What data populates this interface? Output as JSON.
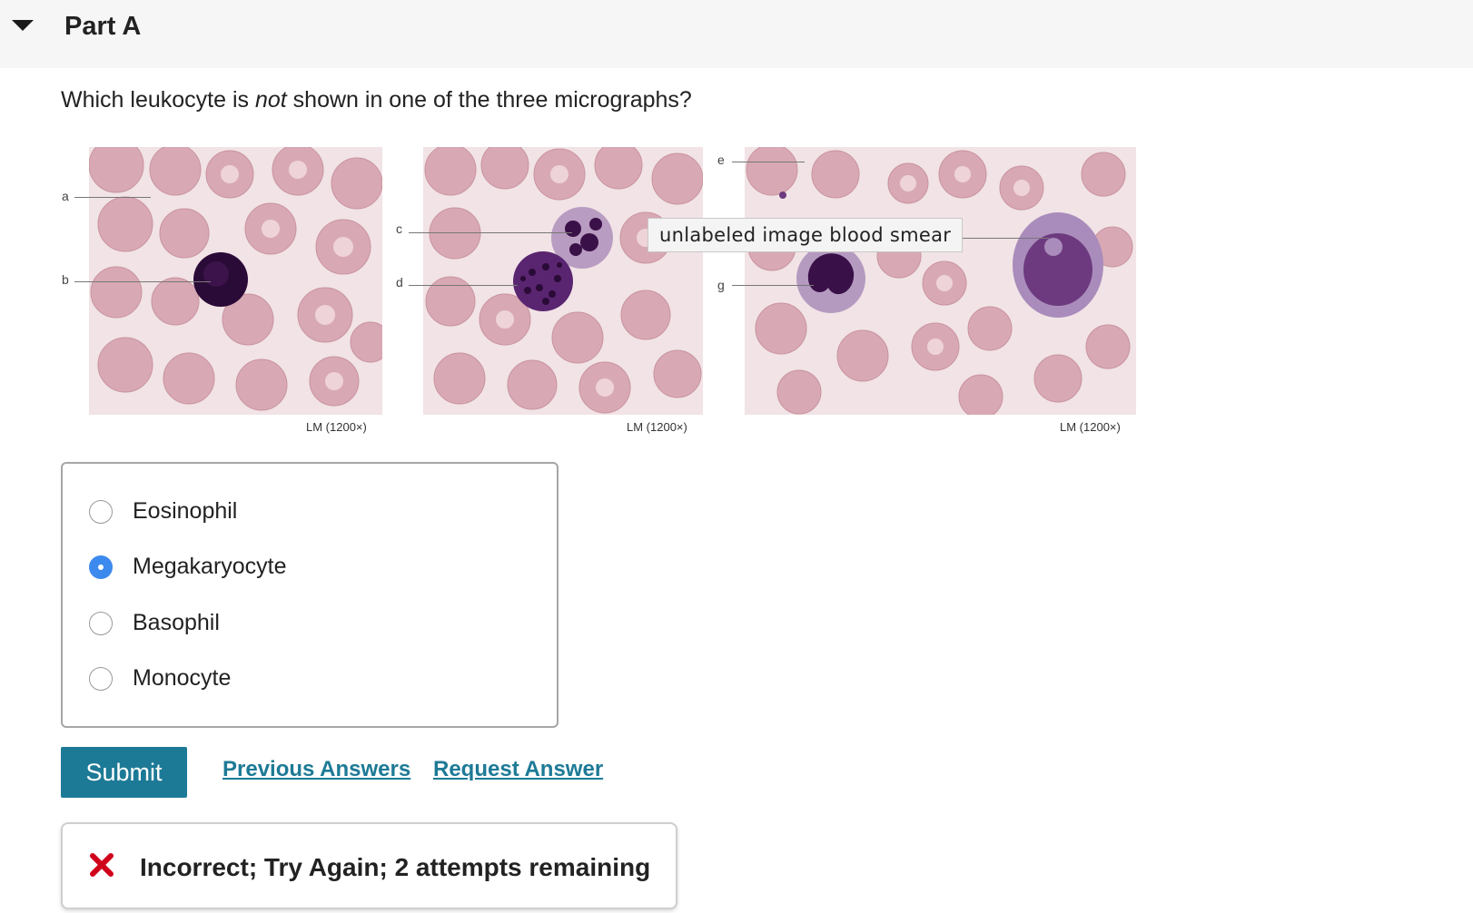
{
  "header": {
    "title": "Part A"
  },
  "question": {
    "prefix": "Which leukocyte is ",
    "emphasis": "not",
    "suffix": " shown in one of the three micrographs?"
  },
  "micrographs": {
    "magnification": [
      "LM (1200×)",
      "LM (1200×)",
      "LM (1200×)"
    ],
    "labels": [
      "a",
      "b",
      "c",
      "d",
      "e",
      "g"
    ],
    "tooltip": "unlabeled image blood smear",
    "colors": {
      "rbc": "#d8a9b4",
      "rbc_center": "#eed3d9",
      "background": "#f1e3e6",
      "nucleus": "#3a1048",
      "granules": "#6d3a7f"
    }
  },
  "choices": {
    "options": [
      {
        "label": "Eosinophil",
        "selected": false
      },
      {
        "label": "Megakaryocyte",
        "selected": true
      },
      {
        "label": "Basophil",
        "selected": false
      },
      {
        "label": "Monocyte",
        "selected": false
      }
    ]
  },
  "actions": {
    "submit_label": "Submit",
    "previous_answers_label": "Previous Answers",
    "request_answer_label": "Request Answer"
  },
  "feedback": {
    "icon": "close-x-icon",
    "text": "Incorrect; Try Again; 2 attempts remaining",
    "icon_color": "#d0021b"
  },
  "theme": {
    "accent": "#1d7a96",
    "radio_selected": "#3d8aee"
  }
}
